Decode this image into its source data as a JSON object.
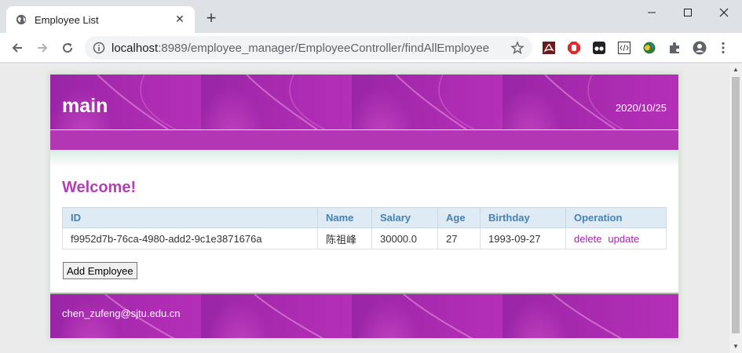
{
  "browser": {
    "tab_title": "Employee List",
    "new_tab_label": "+",
    "url_host": "localhost",
    "url_path": ":8989/employee_manager/EmployeeController/findAllEmployee",
    "extensions": [
      "pdf-icon",
      "adblock-icon",
      "tampermonkey-icon",
      "code-icon",
      "globe-icon",
      "puzzle-icon",
      "profile-icon",
      "menu-icon"
    ]
  },
  "page": {
    "brand": "main",
    "date": "2020/10/25",
    "welcome": "Welcome!",
    "table": {
      "headers": [
        "ID",
        "Name",
        "Salary",
        "Age",
        "Birthday",
        "Operation"
      ],
      "rows": [
        {
          "id": "f9952d7b-76ca-4980-add2-9c1e3871676a",
          "name": "陈祖峰",
          "salary": "30000.0",
          "age": "27",
          "birthday": "1993-09-27",
          "delete_label": "delete",
          "update_label": "update"
        }
      ]
    },
    "add_button": "Add Employee",
    "footer_email": "chen_zufeng@sjtu.edu.cn"
  },
  "colors": {
    "header_purple": "#9a25a6",
    "accent": "#b33eb8",
    "table_header_text": "#4682b4",
    "link": "#9b27a8"
  }
}
